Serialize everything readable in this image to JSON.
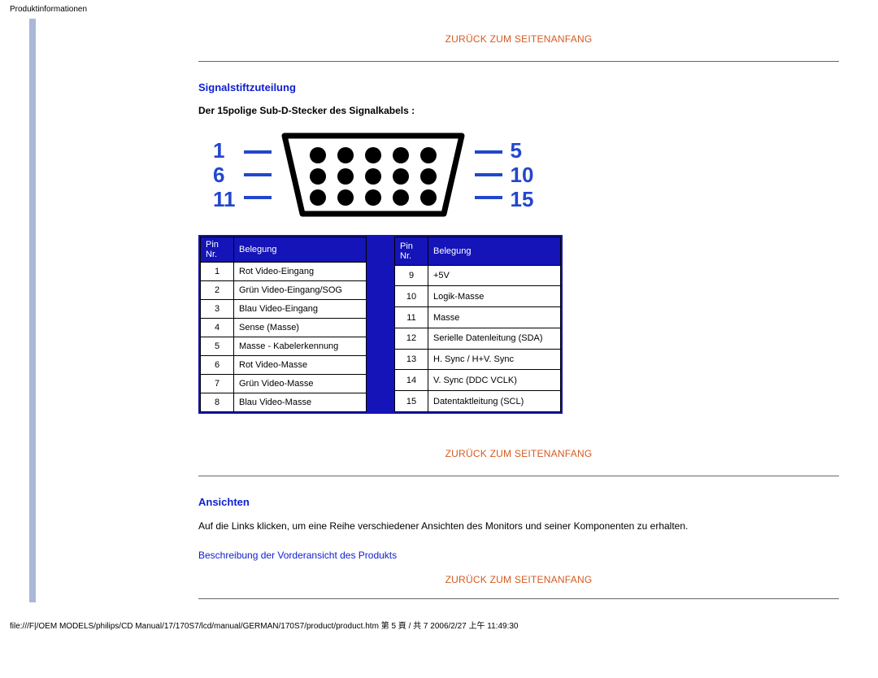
{
  "header": {
    "title": "Produktinformationen"
  },
  "links": {
    "back_to_top": "ZURÜCK ZUM SEITENANFANG",
    "front_view": "Beschreibung der Vorderansicht des Produkts"
  },
  "sections": {
    "pin_assignment": {
      "title": "Signalstiftzuteilung",
      "subtitle": "Der 15polige Sub-D-Stecker des Signalkabels :"
    },
    "views": {
      "title": "Ansichten",
      "body": "Auf die Links klicken, um eine Reihe verschiedener Ansichten des Monitors und seiner Komponenten zu erhalten."
    }
  },
  "connector": {
    "left_labels": [
      "1",
      "6",
      "11"
    ],
    "right_labels": [
      "5",
      "10",
      "15"
    ]
  },
  "pin_table": {
    "headers": {
      "pin": "Pin Nr.",
      "assignment": "Belegung"
    },
    "left": [
      {
        "nr": "1",
        "asg": "Rot Video-Eingang"
      },
      {
        "nr": "2",
        "asg": "Grün Video-Eingang/SOG"
      },
      {
        "nr": "3",
        "asg": "Blau Video-Eingang"
      },
      {
        "nr": "4",
        "asg": "Sense (Masse)"
      },
      {
        "nr": "5",
        "asg": "Masse - Kabelerkennung"
      },
      {
        "nr": "6",
        "asg": "Rot Video-Masse"
      },
      {
        "nr": "7",
        "asg": "Grün Video-Masse"
      },
      {
        "nr": "8",
        "asg": "Blau Video-Masse"
      }
    ],
    "right": [
      {
        "nr": "9",
        "asg": "+5V"
      },
      {
        "nr": "10",
        "asg": "Logik-Masse"
      },
      {
        "nr": "11",
        "asg": "Masse"
      },
      {
        "nr": "12",
        "asg": "Serielle Datenleitung (SDA)"
      },
      {
        "nr": "13",
        "asg": "H. Sync / H+V. Sync"
      },
      {
        "nr": "14",
        "asg": "V. Sync (DDC VCLK)"
      },
      {
        "nr": "15",
        "asg": "Datentaktleitung (SCL)"
      }
    ]
  },
  "footer": {
    "text": "file:///F|/OEM MODELS/philips/CD Manual/17/170S7/lcd/manual/GERMAN/170S7/product/product.htm 第 5 頁 / 共 7 2006/2/27 上午 11:49:30"
  }
}
